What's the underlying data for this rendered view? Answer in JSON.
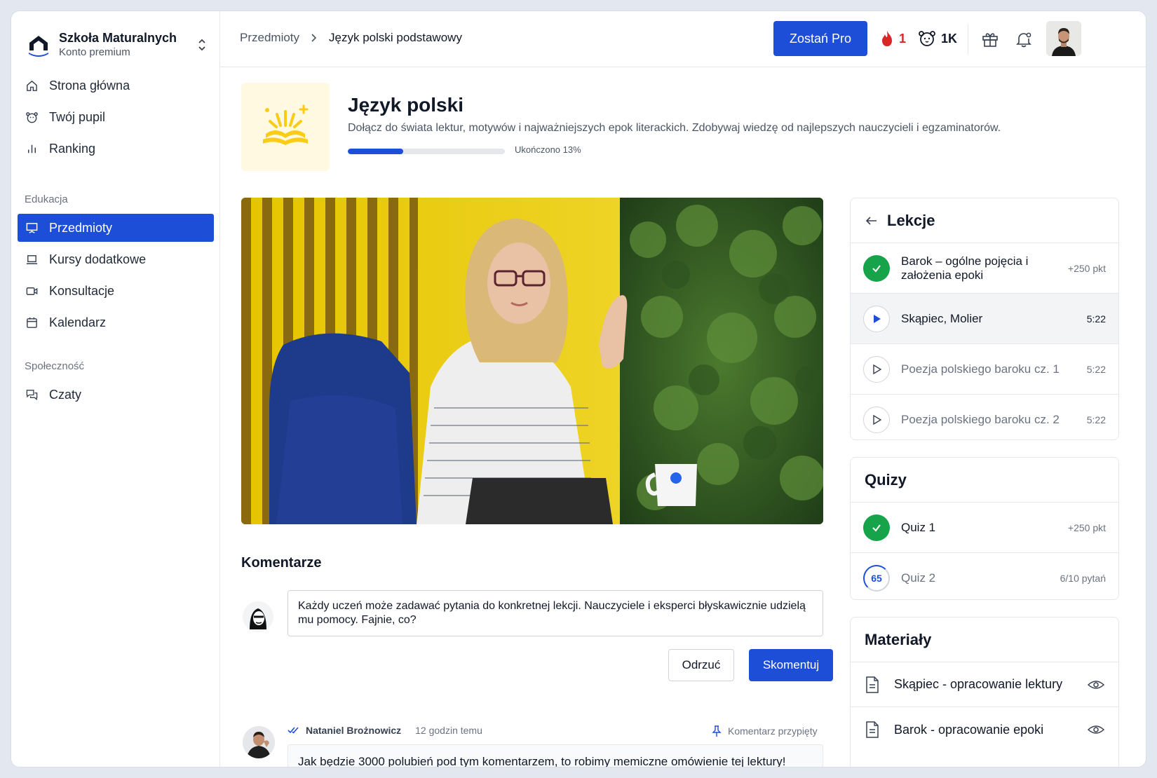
{
  "brand": {
    "name": "Szkoła Maturalnych",
    "subtitle": "Konto premium"
  },
  "sidebar": {
    "items_top": [
      {
        "label": "Strona główna",
        "icon": "home-icon"
      },
      {
        "label": "Twój pupil",
        "icon": "pet-icon"
      },
      {
        "label": "Ranking",
        "icon": "bar-chart-icon"
      }
    ],
    "section_education": "Edukacja",
    "items_education": [
      {
        "label": "Przedmioty",
        "icon": "presentation-icon",
        "active": true
      },
      {
        "label": "Kursy dodatkowe",
        "icon": "laptop-icon"
      },
      {
        "label": "Konsultacje",
        "icon": "video-camera-icon"
      },
      {
        "label": "Kalendarz",
        "icon": "calendar-icon"
      }
    ],
    "section_community": "Społeczność",
    "items_community": [
      {
        "label": "Czaty",
        "icon": "chat-icon"
      }
    ]
  },
  "topbar": {
    "breadcrumb": [
      "Przedmioty",
      "Język polski podstawowy"
    ],
    "pro_button": "Zostań Pro",
    "streak": "1",
    "pet_points": "1K"
  },
  "subject": {
    "title": "Język polski",
    "description": "Dołącz do świata lektur, motywów i najważniejszych epok literackich. Zdobywaj wiedzę od najlepszych nauczycieli i egzaminatorów.",
    "progress_percent": 13,
    "progress_label": "Ukończono 13%"
  },
  "comments": {
    "title": "Komentarze",
    "draft": "Każdy uczeń może zadawać pytania do konkretnej lekcji. Nauczyciele i eksperci błyskawicznie udzielą mu pomocy. Fajnie, co?",
    "cancel_label": "Odrzuć",
    "submit_label": "Skomentuj",
    "items": [
      {
        "author": "Nataniel Brożnowicz",
        "time": "12 godzin temu",
        "pinned_label": "Komentarz przypięty",
        "body": "Jak będzie 3000 polubień pod tym komentarzem, to robimy memiczne omówienie tej lektury!"
      }
    ]
  },
  "lessons": {
    "title": "Lekcje",
    "items": [
      {
        "title": "Barok – ogólne pojęcia i założenia epoki",
        "meta": "+250 pkt",
        "state": "done"
      },
      {
        "title": "Skąpiec, Molier",
        "meta": "5:22",
        "state": "current"
      },
      {
        "title": "Poezja polskiego baroku cz. 1",
        "meta": "5:22",
        "state": "locked"
      },
      {
        "title": "Poezja polskiego baroku cz. 2",
        "meta": "5:22",
        "state": "locked"
      }
    ]
  },
  "quizzes": {
    "title": "Quizy",
    "items": [
      {
        "title": "Quiz 1",
        "meta": "+250 pkt",
        "state": "done"
      },
      {
        "title": "Quiz 2",
        "meta": "6/10 pytań",
        "state": "progress",
        "score": "65"
      }
    ]
  },
  "materials": {
    "title": "Materiały",
    "items": [
      {
        "title": "Skąpiec - opracowanie lektury"
      },
      {
        "title": "Barok - opracowanie epoki"
      }
    ]
  },
  "colors": {
    "accent": "#1d4ed8",
    "success": "#16a34a",
    "streak": "#dc2626"
  }
}
